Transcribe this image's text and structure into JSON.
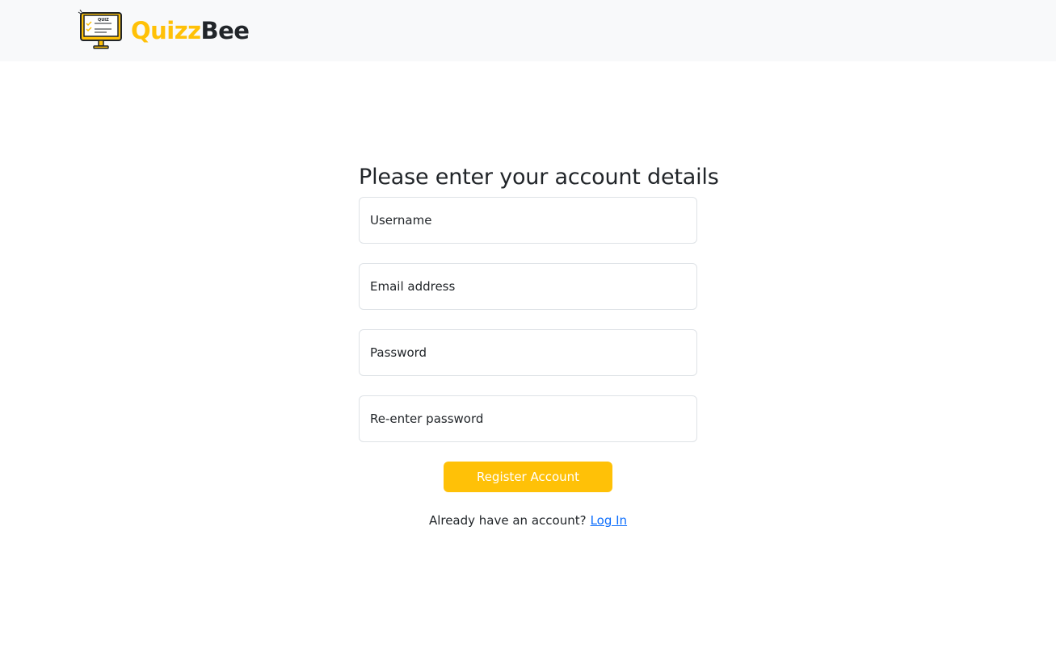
{
  "navbar": {
    "brand": {
      "part1": "Quizz",
      "part2": "Bee",
      "logo_icon": "quiz-monitor-icon",
      "logo_text": "QUIZ",
      "accent_color": "#ffc107"
    }
  },
  "form": {
    "title": "Please enter your account details",
    "fields": [
      {
        "placeholder": "Username",
        "value": ""
      },
      {
        "placeholder": "Email address",
        "value": ""
      },
      {
        "placeholder": "Password",
        "value": ""
      },
      {
        "placeholder": "Re-enter password",
        "value": ""
      }
    ],
    "submit_label": "Register Account",
    "submit_color": "#ffc107",
    "login_prompt": "Already have an account?",
    "login_link": "Log In",
    "link_color": "#0d6efd"
  }
}
